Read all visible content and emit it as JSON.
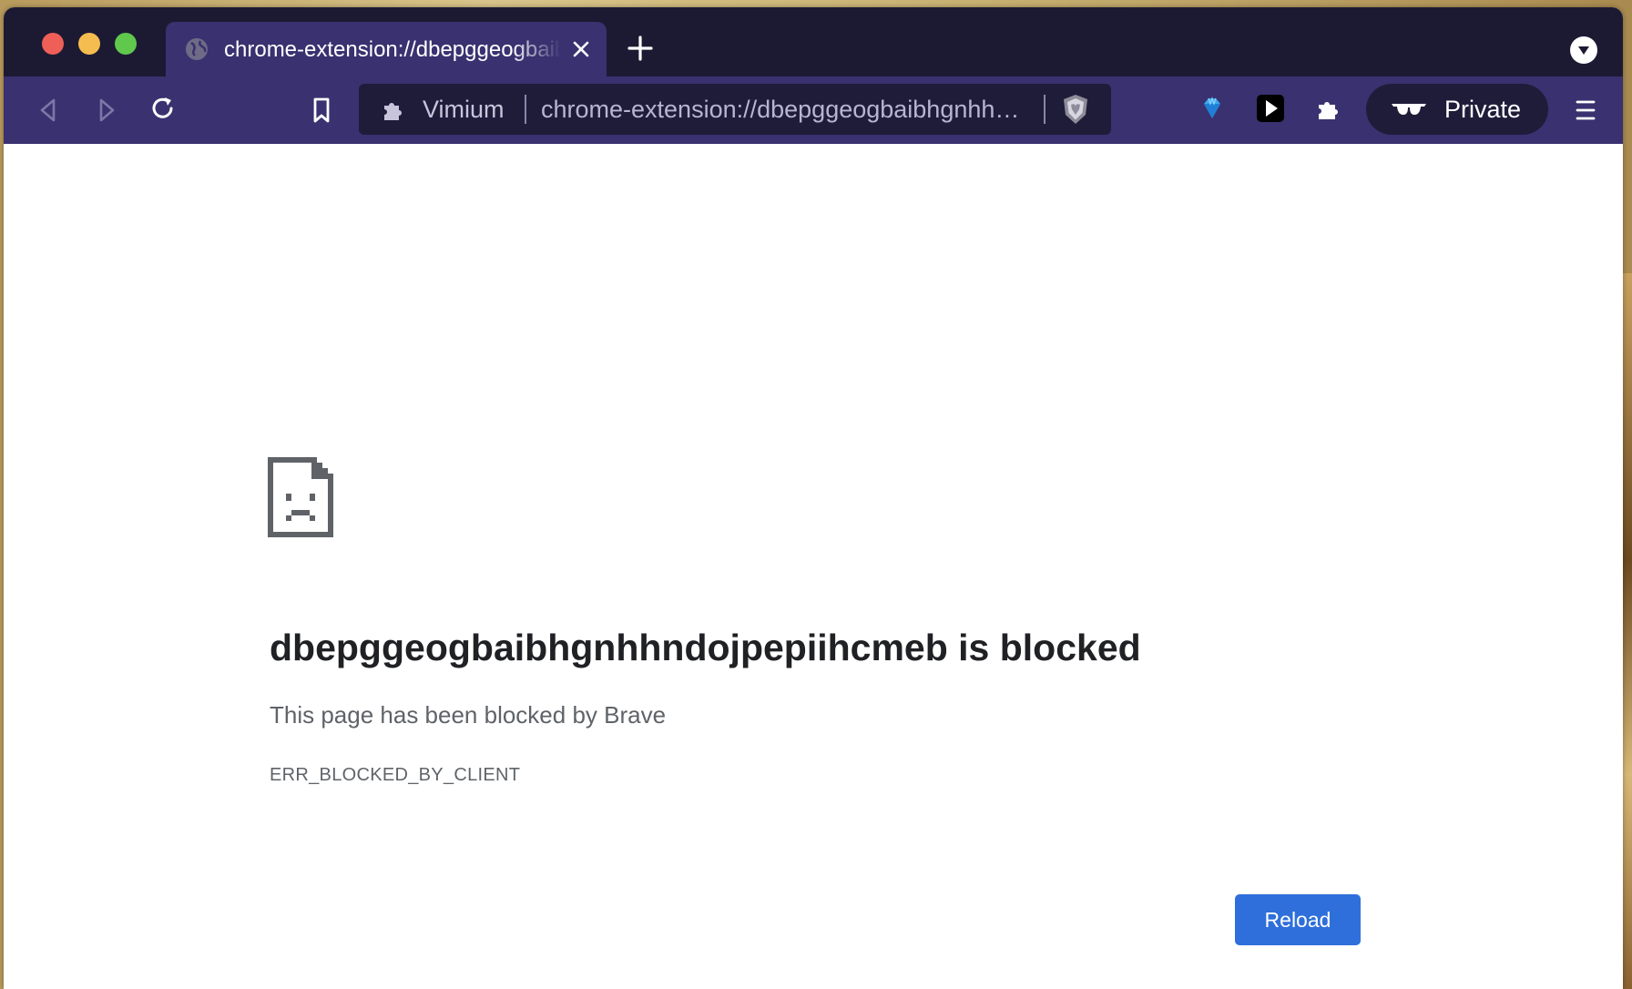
{
  "tab": {
    "title": "chrome-extension://dbepggeogbaibhgnhhndojpepiihcmeb",
    "favicon": "globe-icon",
    "close": "close-icon"
  },
  "tabstrip": {
    "new_tab": "plus-icon",
    "dropdown": "chevron-down-icon"
  },
  "toolbar": {
    "back": "back-arrow-icon",
    "forward": "forward-arrow-icon",
    "reload": "reload-icon",
    "bookmark": "bookmark-icon",
    "address": {
      "extension_icon": "puzzle-icon",
      "extension_name": "Vimium",
      "url": "chrome-extension://dbepggeogbaibhgnhhndojpepiihcmeb/pages/help_dialog.html"
    },
    "shield": "brave-shield-icon",
    "extensions_right": [
      "gem-icon",
      "play-icon",
      "puzzle-icon"
    ],
    "private_label": "Private",
    "private_icon": "sunglasses-icon",
    "menu": "hamburger-menu-icon"
  },
  "error": {
    "icon": "sad-document-icon",
    "heading": "dbepggeogbaibhgnhhndojpepiihcmeb is blocked",
    "subtext": "This page has been blocked by Brave",
    "code": "ERR_BLOCKED_BY_CLIENT",
    "reload_label": "Reload"
  },
  "colors": {
    "tabstrip_bg": "#1c1a33",
    "toolbar_bg": "#3a3170",
    "addressbar_bg": "#1f1c3a",
    "reload_button": "#2f6fdb"
  }
}
